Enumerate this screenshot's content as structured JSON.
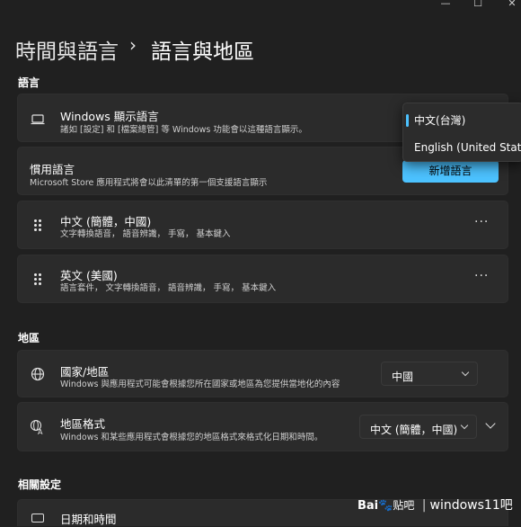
{
  "window": {
    "minimize_glyph": "—",
    "maximize_glyph": "☐",
    "close_glyph": "✕"
  },
  "breadcrumb": {
    "parent": "時間與語言",
    "separator": "›",
    "current": "語言與地區"
  },
  "language_section": {
    "label": "語言",
    "display_language": {
      "title": "Windows 顯示語言",
      "subtitle": "諸如 [設定] 和 [檔案總管] 等 Windows 功能會以這種語言顯示。",
      "icon": "monitor-icon",
      "dropdown_open": true,
      "options": [
        {
          "label": "中文(台灣)",
          "selected": true
        },
        {
          "label": "English (United States)",
          "selected": false
        }
      ]
    },
    "preferred_languages": {
      "title": "慣用語言",
      "subtitle": "Microsoft Store 應用程式將會以此清單的第一個支援語言顯示",
      "add_button": "新增語言"
    },
    "languages": [
      {
        "name": "中文 (簡體，中國)",
        "features": "文字轉換語音， 語音辨識， 手寫， 基本鍵入",
        "more": "···"
      },
      {
        "name": "英文 (美國)",
        "features": "語言套件， 文字轉換語音， 語音辨識， 手寫， 基本鍵入",
        "more": "···"
      }
    ]
  },
  "region_section": {
    "label": "地區",
    "country": {
      "title": "國家/地區",
      "subtitle": "Windows 與應用程式可能會根據您所在國家或地區為您提供當地化的內容",
      "value": "中國",
      "icon": "globe-icon"
    },
    "format": {
      "title": "地區格式",
      "subtitle": "Windows 和某些應用程式會根據您的地區格式來格式化日期和時間。",
      "value": "中文 (簡體，中國)",
      "icon": "region-format-icon"
    }
  },
  "related_section": {
    "label": "相關設定",
    "date_time": {
      "title": "日期和時間"
    }
  },
  "watermark": {
    "brand": "Bai",
    "brand2": "贴吧",
    "divider": "|",
    "text": "windows11吧"
  },
  "colors": {
    "accent": "#4cc2ff",
    "background": "#202020",
    "card": "#2b2b2b"
  }
}
